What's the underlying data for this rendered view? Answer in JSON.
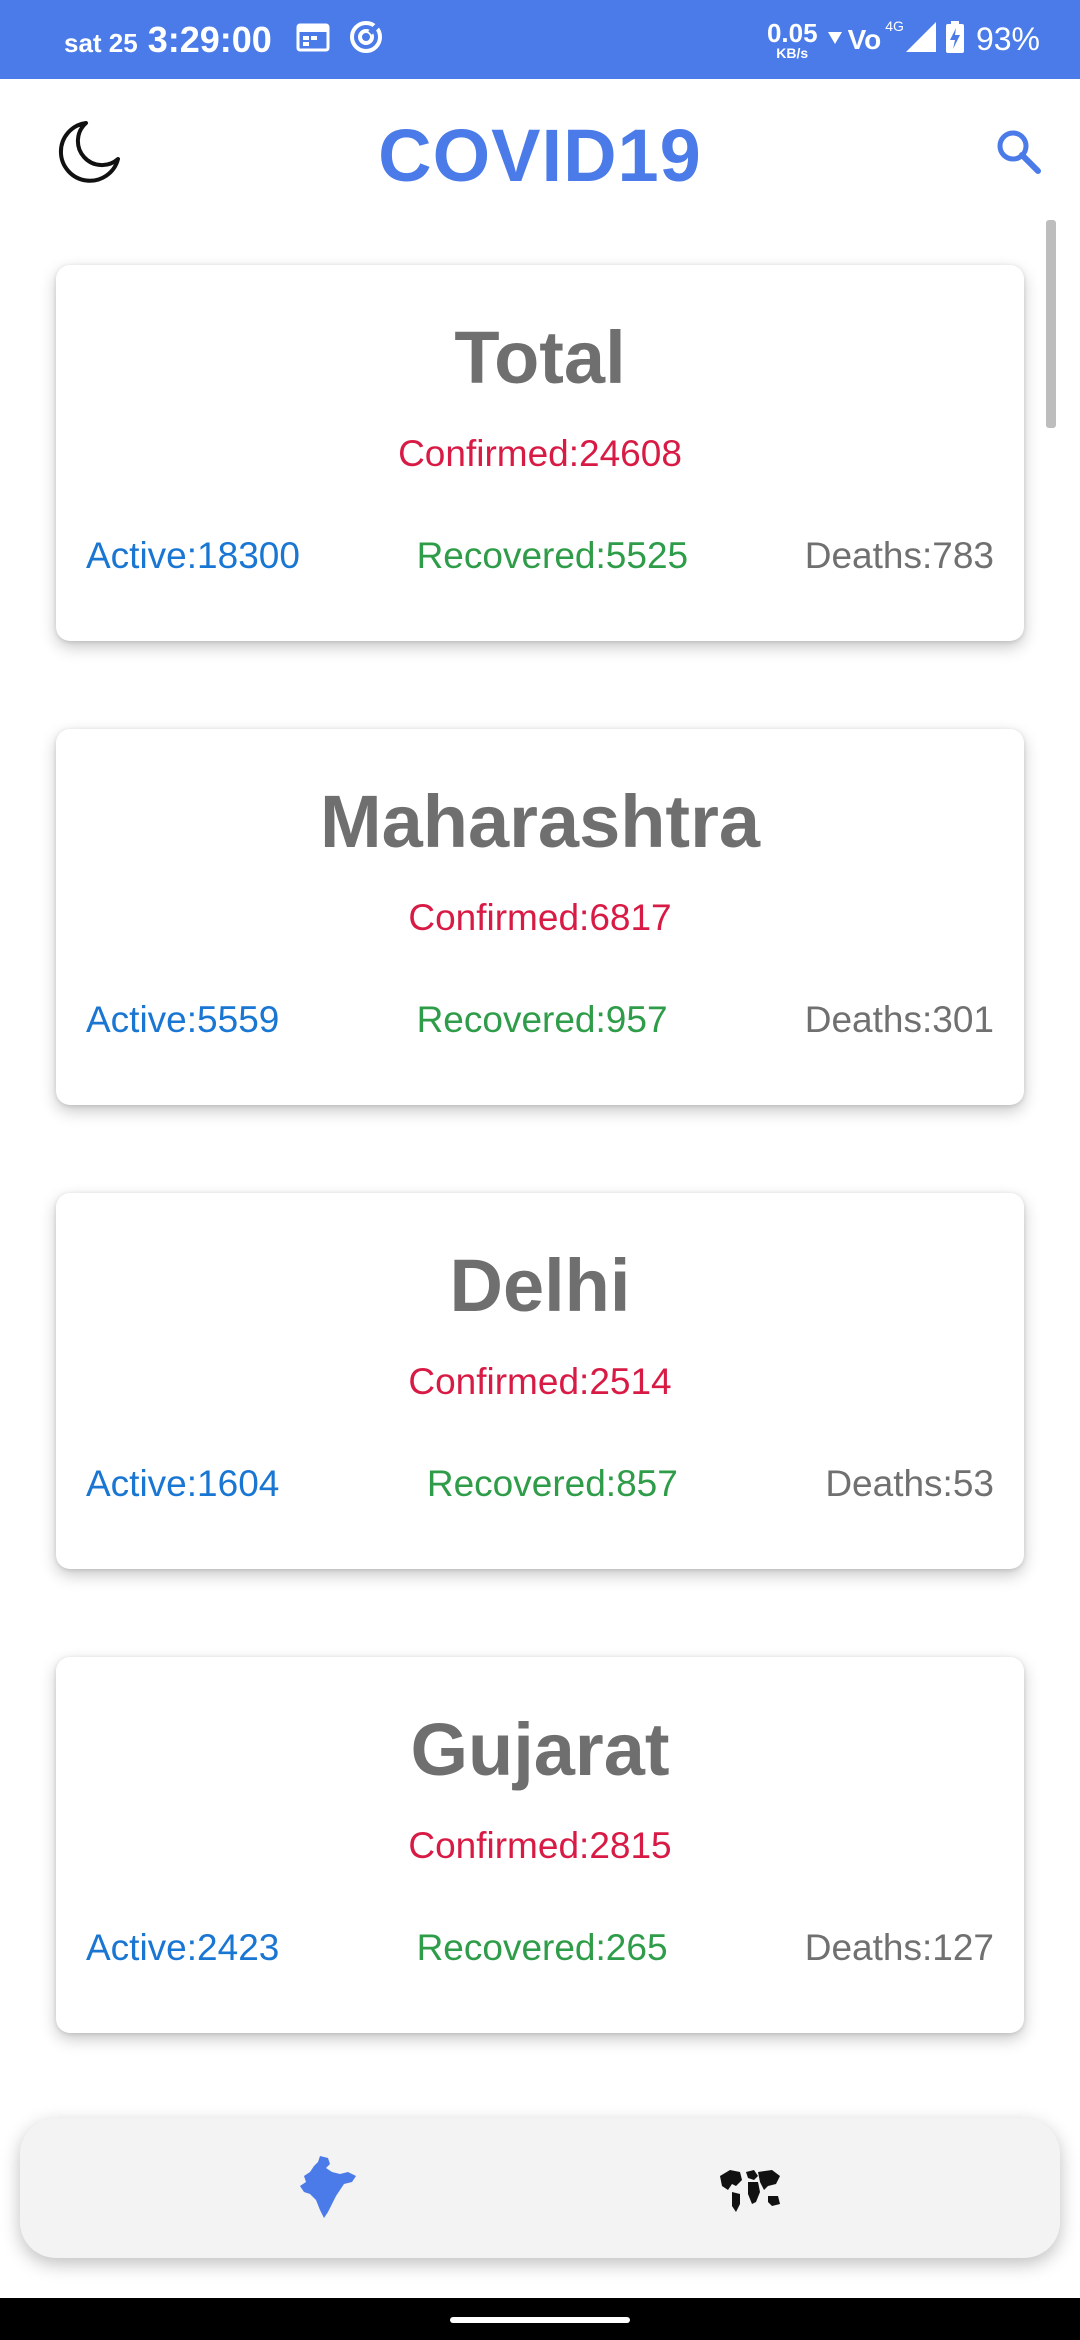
{
  "status_bar": {
    "date": "sat 25",
    "time": "3:29:00",
    "net_speed_value": "0.05",
    "net_speed_unit": "KB/s",
    "network_type": "4G",
    "volte_label": "Vo",
    "battery_percent": "93%"
  },
  "app_bar": {
    "title": "COVID19"
  },
  "cards": [
    {
      "title": "Total",
      "confirmed": "Confirmed:24608",
      "active": "Active:18300",
      "recovered": "Recovered:5525",
      "deaths": "Deaths:783"
    },
    {
      "title": "Maharashtra",
      "confirmed": "Confirmed:6817",
      "active": "Active:5559",
      "recovered": "Recovered:957",
      "deaths": "Deaths:301"
    },
    {
      "title": "Delhi",
      "confirmed": "Confirmed:2514",
      "active": "Active:1604",
      "recovered": "Recovered:857",
      "deaths": "Deaths:53"
    },
    {
      "title": "Gujarat",
      "confirmed": "Confirmed:2815",
      "active": "Active:2423",
      "recovered": "Recovered:265",
      "deaths": "Deaths:127"
    }
  ],
  "icons": {
    "theme_toggle": "moon-icon",
    "search": "search-icon",
    "nav_india": "india-map-icon",
    "nav_world": "world-map-icon"
  },
  "colors": {
    "primary": "#4a7be8",
    "confirmed": "#d81b45",
    "active": "#1976d2",
    "recovered": "#2e9c48",
    "deaths": "#707070"
  }
}
